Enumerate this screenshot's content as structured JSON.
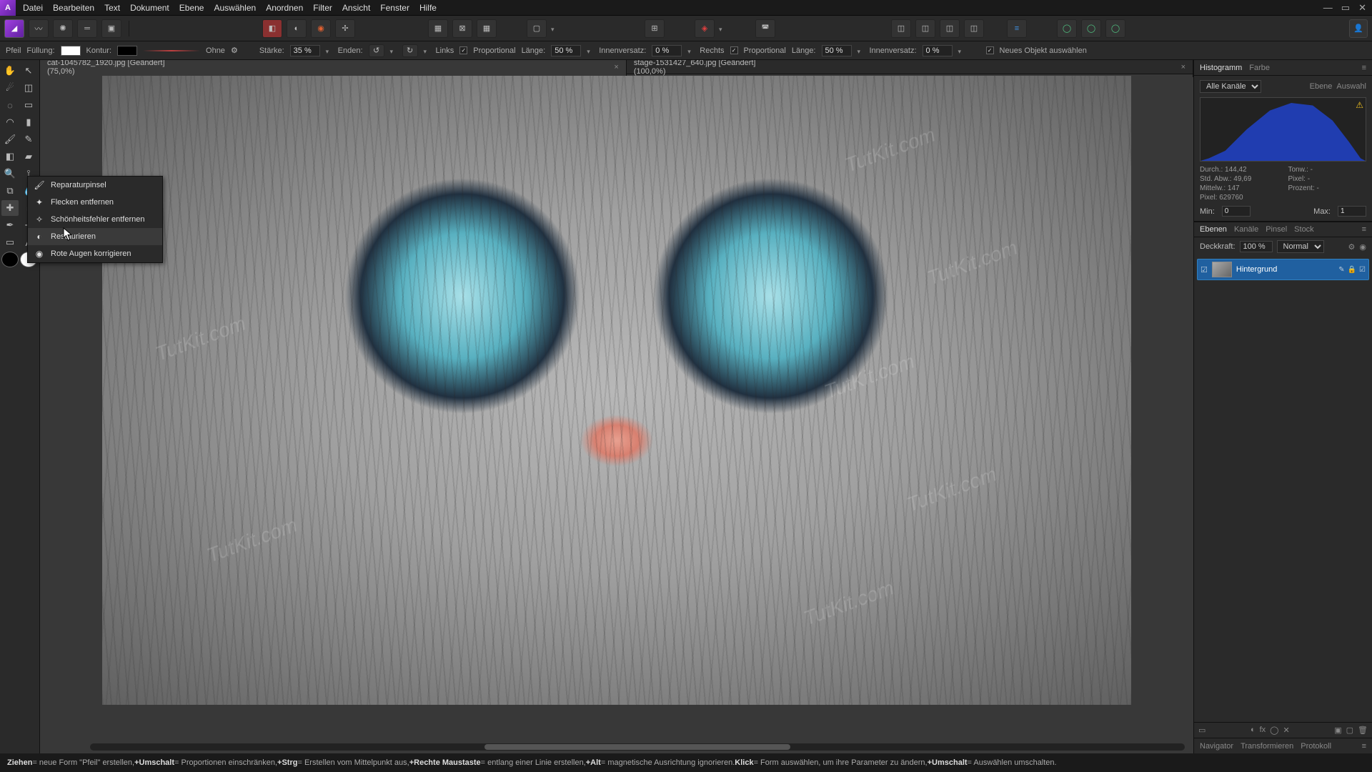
{
  "app_icon": "A",
  "menu": [
    "Datei",
    "Bearbeiten",
    "Text",
    "Dokument",
    "Ebene",
    "Auswählen",
    "Anordnen",
    "Filter",
    "Ansicht",
    "Fenster",
    "Hilfe"
  ],
  "optbar": {
    "tool": "Pfeil",
    "fill_lbl": "Füllung:",
    "stroke_lbl": "Kontur:",
    "stroke_style": "Ohne",
    "strength_lbl": "Stärke:",
    "strength": "35 %",
    "ends_lbl": "Enden:",
    "left_lbl": "Links",
    "prop_lbl": "Proportional",
    "len_lbl": "Länge:",
    "len": "50 %",
    "inset_lbl": "Innenversatz:",
    "inset": "0 %",
    "right_lbl": "Rechts",
    "len2": "50 %",
    "inset2": "0 %",
    "newobj": "Neues Objekt auswählen"
  },
  "tabs": [
    {
      "label": "cat-1045782_1920.jpg [Geändert] (75,0%)",
      "active": true
    },
    {
      "label": "stage-1531427_640.jpg [Geändert] (100,0%)",
      "active": false
    }
  ],
  "flyout": [
    {
      "icon": "🖌",
      "label": "Reparaturpinsel"
    },
    {
      "icon": "✦",
      "label": "Flecken entfernen"
    },
    {
      "icon": "✧",
      "label": "Schönheitsfehler entfernen"
    },
    {
      "icon": "◐",
      "label": "Restaurieren",
      "hl": true
    },
    {
      "icon": "◉",
      "label": "Rote Augen korrigieren"
    }
  ],
  "right": {
    "tabs1": [
      "Histogramm",
      "Farbe"
    ],
    "channel": "Alle Kanäle",
    "subtabs": [
      "Ebene",
      "Auswahl"
    ],
    "stats": {
      "durch": "Durch.: 144,42",
      "tonw": "Tonw.: -",
      "std": "Std. Abw.: 49,69",
      "pixel2": "Pixel: -",
      "mittelw": "Mittelw.: 147",
      "prozent": "Prozent: -",
      "pixel": "Pixel: 629760"
    },
    "min_lbl": "Min:",
    "min": "0",
    "max_lbl": "Max:",
    "max": "1",
    "tabs2": [
      "Ebenen",
      "Kanäle",
      "Pinsel",
      "Stock"
    ],
    "opacity_lbl": "Deckkraft:",
    "opacity": "100 %",
    "blend": "Normal",
    "layer_name": "Hintergrund",
    "tabs3": [
      "Navigator",
      "Transformieren",
      "Protokoll"
    ]
  },
  "status": {
    "ziehen": "Ziehen",
    "ziehen_t": " = neue Form \"Pfeil\" erstellen, ",
    "umsch": "+Umschalt",
    "umsch_t": " = Proportionen einschränken, ",
    "strg": "+Strg",
    "strg_t": " = Erstellen vom Mittelpunkt aus, ",
    "rmb": "+Rechte Maustaste",
    "rmb_t": " = entlang einer Linie erstellen, ",
    "alt": "+Alt",
    "alt_t": " = magnetische Ausrichtung ignorieren. ",
    "klick": "Klick",
    "klick_t": " = Form auswählen, um ihre Parameter zu ändern, ",
    "umsch2": "+Umschalt",
    "umsch2_t": " = Auswählen umschalten."
  },
  "watermark": "TutKit.com"
}
